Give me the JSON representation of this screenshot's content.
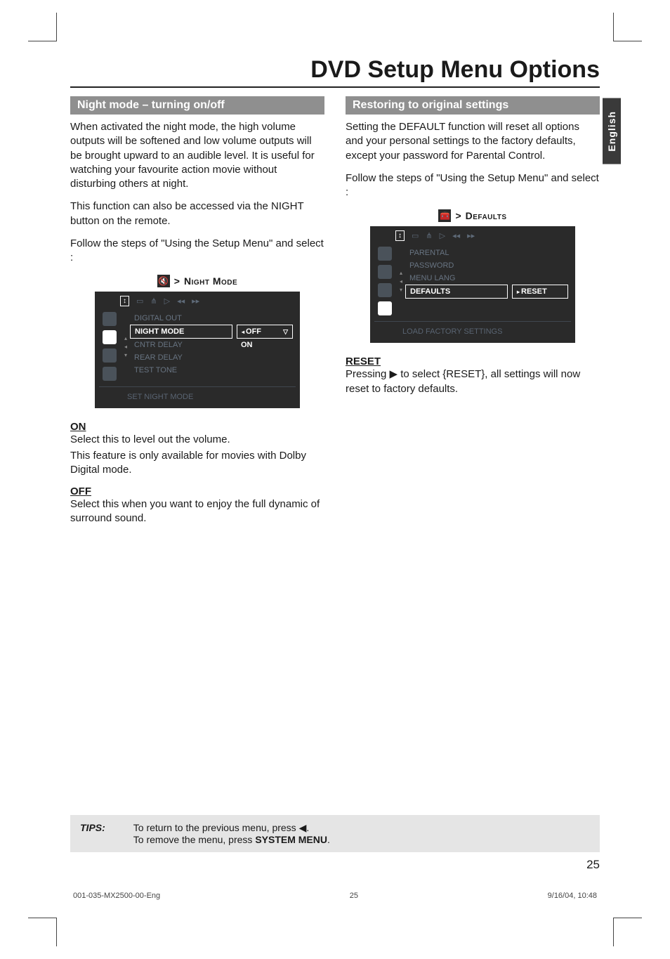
{
  "language_tab": "English",
  "page_title": "DVD Setup Menu Options",
  "left": {
    "section_heading": "Night mode – turning on/off",
    "para1": "When activated the night mode, the high volume outputs will be softened and low volume outputs will be brought upward to an audible level.  It is useful for watching your favourite action movie without disturbing others at night.",
    "para2": "This function can also be accessed via the NIGHT button on the remote.",
    "para3": "Follow the steps of \"Using the Setup Menu\" and select :",
    "breadcrumb_label": "Night Mode",
    "osd": {
      "items": [
        "DIGITAL OUT",
        "NIGHT MODE",
        "CNTR DELAY",
        "REAR DELAY",
        "TEST TONE"
      ],
      "selected_index": 1,
      "values": [
        "OFF",
        "ON"
      ],
      "helper": "SET NIGHT MODE"
    },
    "on_head": "ON",
    "on_text1": "Select this to level out the volume.",
    "on_text2": "This feature is only available for movies with Dolby Digital mode.",
    "off_head": "OFF",
    "off_text": "Select this when you want to enjoy the full dynamic of surround sound."
  },
  "right": {
    "section_heading": "Restoring to original settings",
    "para1": "Setting the DEFAULT function will reset all options and your personal settings to the factory defaults, except your password for Parental Control.",
    "para2": "Follow the steps of \"Using the Setup Menu\" and select :",
    "breadcrumb_label": "Defaults",
    "osd": {
      "items": [
        "PARENTAL",
        "PASSWORD",
        "MENU LANG",
        "DEFAULTS"
      ],
      "selected_index": 3,
      "values": [
        "RESET"
      ],
      "helper": "LOAD FACTORY SETTINGS"
    },
    "reset_head": "RESET",
    "reset_text_a": "Pressing ",
    "reset_text_b": " to select {RESET},  all settings will now reset to factory defaults."
  },
  "tips": {
    "label": "TIPS:",
    "line1a": "To return to the previous menu, press ",
    "line1b": ".",
    "line2a": "To remove the menu, press ",
    "line2b": "SYSTEM MENU",
    "line2c": "."
  },
  "page_number": "25",
  "footer": {
    "doc": "001-035-MX2500-00-Eng",
    "page": "25",
    "date": "9/16/04, 10:48"
  }
}
